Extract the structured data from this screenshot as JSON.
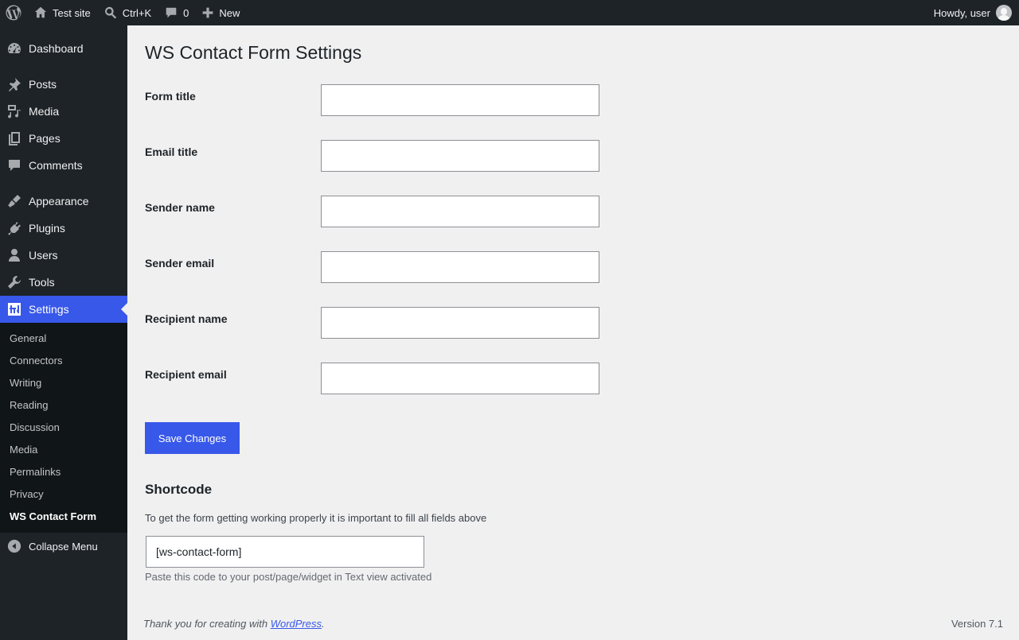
{
  "admin_bar": {
    "site_name": "Test site",
    "search_shortcut": "Ctrl+K",
    "comments_count": "0",
    "new_label": "New",
    "greeting": "Howdy, user"
  },
  "sidebar": {
    "items": [
      {
        "label": "Dashboard",
        "icon": "dashboard-icon"
      },
      {
        "label": "Posts",
        "icon": "pin-icon"
      },
      {
        "label": "Media",
        "icon": "media-icon"
      },
      {
        "label": "Pages",
        "icon": "pages-icon"
      },
      {
        "label": "Comments",
        "icon": "comment-icon"
      },
      {
        "label": "Appearance",
        "icon": "brush-icon"
      },
      {
        "label": "Plugins",
        "icon": "plugin-icon"
      },
      {
        "label": "Users",
        "icon": "user-icon"
      },
      {
        "label": "Tools",
        "icon": "wrench-icon"
      },
      {
        "label": "Settings",
        "icon": "settings-icon"
      }
    ],
    "submenu": [
      "General",
      "Connectors",
      "Writing",
      "Reading",
      "Discussion",
      "Media",
      "Permalinks",
      "Privacy",
      "WS Contact Form"
    ],
    "collapse_label": "Collapse Menu"
  },
  "page": {
    "title": "WS Contact Form Settings",
    "fields": [
      {
        "label": "Form title",
        "value": ""
      },
      {
        "label": "Email title",
        "value": ""
      },
      {
        "label": "Sender name",
        "value": ""
      },
      {
        "label": "Sender email",
        "value": ""
      },
      {
        "label": "Recipient name",
        "value": ""
      },
      {
        "label": "Recipient email",
        "value": ""
      }
    ],
    "save_label": "Save Changes",
    "shortcode": {
      "title": "Shortcode",
      "description": "To get the form getting working properly it is important to fill all fields above",
      "value": "[ws-contact-form]",
      "hint": "Paste this code to your post/page/widget in Text view activated"
    }
  },
  "footer": {
    "thanks_prefix": "Thank you for creating with ",
    "link_text": "WordPress",
    "thanks_suffix": ".",
    "version": "Version 7.1"
  },
  "colors": {
    "admin_bar": "#1d2327",
    "accent": "#3858e9",
    "background": "#f0f0f1"
  }
}
